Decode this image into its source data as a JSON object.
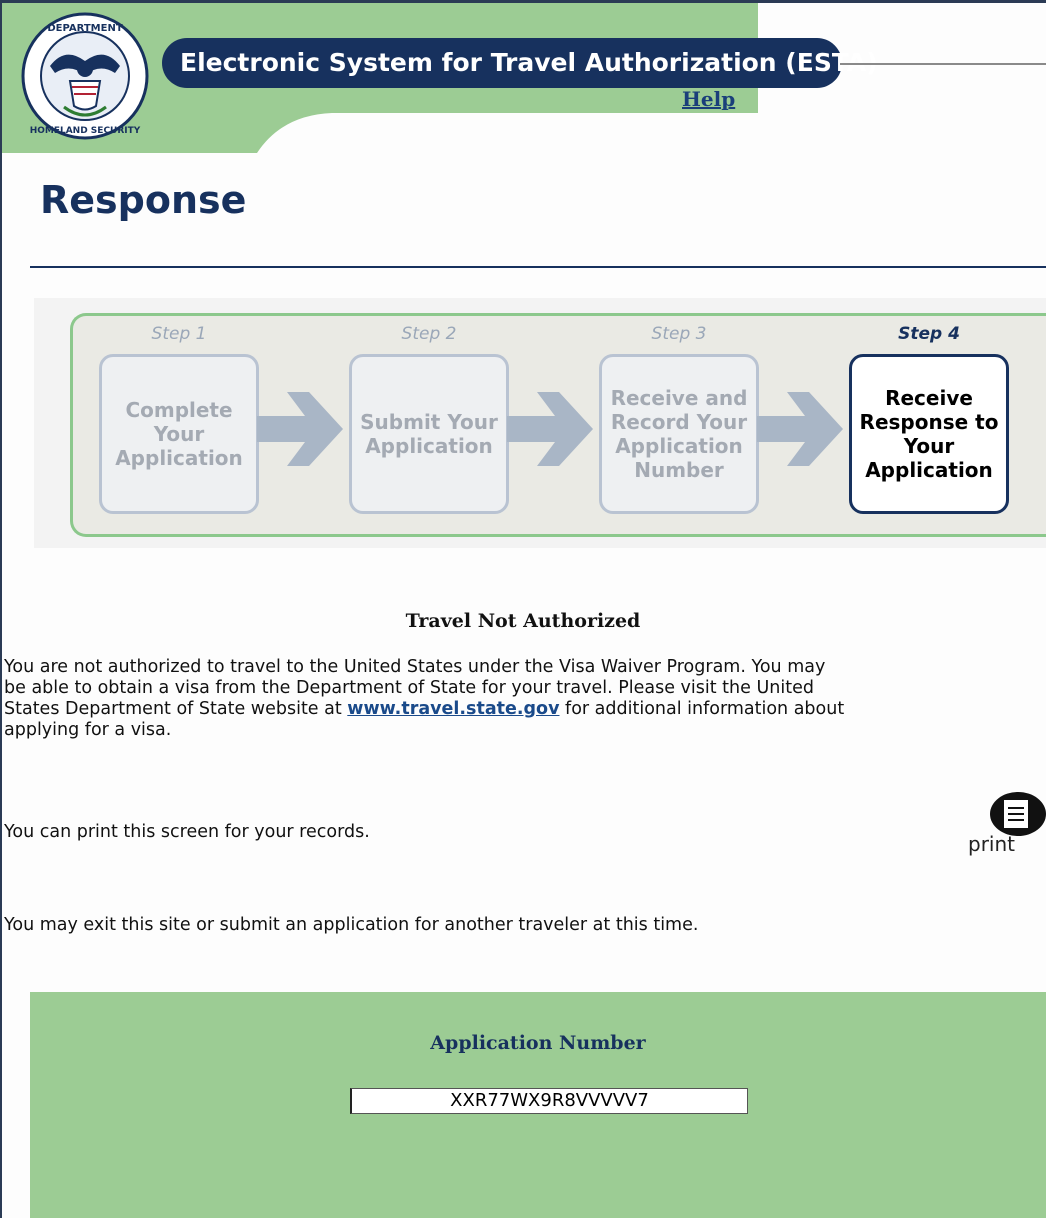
{
  "header": {
    "system_title": "Electronic System for Travel Authorization (ESTA)",
    "help_label": "Help",
    "seal_text": "U.S. DEPARTMENT OF HOMELAND SECURITY"
  },
  "page_title": "Response",
  "steps": [
    {
      "label": "Step 1",
      "text": "Complete Your Application",
      "active": false
    },
    {
      "label": "Step 2",
      "text": "Submit Your Application",
      "active": false
    },
    {
      "label": "Step 3",
      "text": "Receive and Record Your Application Number",
      "active": false
    },
    {
      "label": "Step 4",
      "text": "Receive Response to Your Application",
      "active": true
    }
  ],
  "notice": {
    "heading": "Travel Not Authorized",
    "line1": "You are not authorized to travel to the United States under the Visa Waiver Program. You may",
    "line2": "be able to obtain a visa from the Department of State for your travel. Please visit the United",
    "line3_before": "States Department of State website at ",
    "link": "www.travel.state.gov",
    "line3_after": " for additional information about",
    "line4": "applying for a visa."
  },
  "print_prompt": "You can print this screen for your records.",
  "print_label": "print",
  "exit_text": "You may exit this site or submit an application for another traveler at this time.",
  "application": {
    "label": "Application Number",
    "value": "XXR77WX9R8VVVVV7"
  },
  "colors": {
    "navy": "#17315e",
    "header_green": "#9ccc94",
    "panel_green": "#9ccc94",
    "link_blue": "#1a4a8a"
  }
}
